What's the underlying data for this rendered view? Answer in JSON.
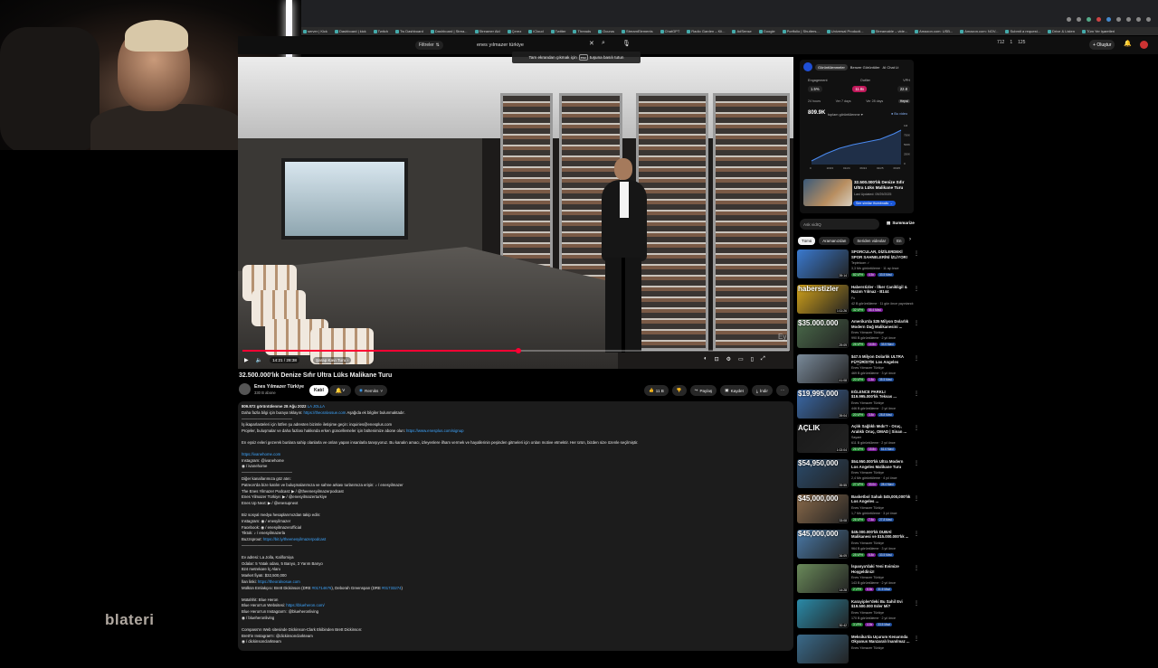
{
  "browser": {
    "bookmarks": [
      "server | Kick",
      "Dashboard | kick",
      "Twitch",
      "Tw Dashboard",
      "Dashboard | Strea...",
      "Streamer Aid",
      "Çerez",
      "iCloud",
      "Twitter",
      "Threads",
      "Ocurus",
      "StreamElements",
      "ChatGPT",
      "Radio Garden – Kli...",
      "AdSense",
      "Google",
      "Portfolio | Shutters...",
      "Universal Producti...",
      "Streamable – vide...",
      "Amazon.com: USB...",
      "Amazon.com: NOV...",
      "Submit a request...",
      "Drive & Listen",
      "Tüm Yer işaretleri"
    ]
  },
  "youtube": {
    "filters_label": "Filtreler",
    "search_query": "enes yılmazer türkiye",
    "create_label": "Oluştur",
    "counters": [
      "712",
      "1",
      "125"
    ],
    "toast": {
      "before": "Tam ekrandan çıkmak için",
      "key": "esc",
      "after": "tuşuna basılı tutun"
    }
  },
  "player": {
    "time": "14:21 / 28:38",
    "chapter": "Şarap Kavı Turu ›",
    "progress_fraction": 0.505,
    "watermark": "Ey"
  },
  "video": {
    "title": "32.500.000'lık Denize Sıfır Ultra Lüks Malikane Turu",
    "channel": "Enes Yılmazer Türkiye",
    "subscribers": "330 B abone",
    "join": "Katıl",
    "remix": "Remiks",
    "likes": "11 B",
    "share": "Paylaş",
    "save": "Kaydet",
    "download": "İndir"
  },
  "description": {
    "stats": "809.872 görüntülenme  28 Ağu 2022",
    "stats_link": "LA JOLLA",
    "lines": [
      [
        {
          "t": "Daha fazla bilgi için buraya tıklayın: "
        },
        {
          "t": "https://theoralvosue.com",
          "l": 1
        },
        {
          "t": " Aşağıda ek bilgiler bulunmaktadır."
        }
      ],
      [
        {
          "t": "—————————————"
        }
      ],
      [
        {
          "t": "İş ikaparlasteleri için lütfen şu adresten bizimle iletişime geçin: inquiries@enesplus.com"
        }
      ],
      [
        {
          "t": "Projeler, buluşmalar ve daha fazlası hakkında erken güncellemeler için bültenimize abone olun: "
        },
        {
          "t": "https://www.enesplus.com/signup",
          "l": 1
        }
      ],
      [],
      [
        {
          "t": "En eşsiz evleri gezerek bunlara sahip olanlarla ve onları yapan insanlarla tanışıyoruz. Bu kanalın amacı, izleyenlere ilham vermek ve hayallerinin peşinden gitmeleri için onları motive etmektir. Her ürün, bizden size özenle seçilmiştir."
        }
      ],
      [],
      [
        {
          "t": "https://ivanehome.com",
          "l": 1
        }
      ],
      [
        {
          "t": "Instagram: @ivanehome"
        }
      ],
      [
        {
          "t": "◉ / ivanehome"
        }
      ],
      [
        {
          "t": "—————————————"
        }
      ],
      [
        {
          "t": "Diğer kanallarımıza göz atın:"
        }
      ],
      [
        {
          "t": "Patreon'da bize katılın ve buluşmalarımıza ve sahne arkası turlarımıza erişin: ♪ / enesyilmazer"
        }
      ],
      [
        {
          "t": "The Enes Yilmazer Podcast: ▶ / @theenesyilmazerpodcast"
        }
      ],
      [
        {
          "t": "Enes Yilmazer Türkiye: ▶ / @enesyilmazerturkiye"
        }
      ],
      [
        {
          "t": "Enes Up Next: ▶ / @enesupnext"
        }
      ],
      [],
      [
        {
          "t": "Biz sosyal medya hesaplarımızdan takip edin:"
        }
      ],
      [
        {
          "t": "Instagram: ◉ / enesyilmazer"
        }
      ],
      [
        {
          "t": "Facebook: ◉ / enesyilmazerofficial"
        }
      ],
      [
        {
          "t": "Tiktok: ♪ / enesyilmazerla"
        }
      ],
      [
        {
          "t": "Buzzsprout: "
        },
        {
          "t": "https://bit.ly/theenesyilmazerpodcast",
          "l": 1
        }
      ],
      [
        {
          "t": "—————————————"
        }
      ],
      [],
      [
        {
          "t": "Ev adresi: La Jolla, Kaliforniya"
        }
      ],
      [
        {
          "t": "Odalar: 5 Yatak odası, 5 Banyo, 3 Yarım Banyo"
        }
      ],
      [
        {
          "t": "824 metrekare İç Alanı"
        }
      ],
      [
        {
          "t": "Market fiyatı: $32,500,000"
        }
      ],
      [
        {
          "t": "İlan linki: "
        },
        {
          "t": "https://theoralvosue.com",
          "l": 1
        }
      ],
      [
        {
          "t": "Mülkün Emlakçısı: Brett Dickinson (DRE "
        },
        {
          "t": "#01714676",
          "l": 1
        },
        {
          "t": "), Deborah Greenspan (DRE "
        },
        {
          "t": "#01733274",
          "l": 1
        },
        {
          "t": ")"
        }
      ],
      [],
      [
        {
          "t": "Mütahhit: Blue Heron"
        }
      ],
      [
        {
          "t": "Blue Heron'un Websitesi: "
        },
        {
          "t": "https://blueheron.com/",
          "l": 1
        }
      ],
      [
        {
          "t": "Blue Heron'un Instagram'ı: @blueheronliving"
        }
      ],
      [
        {
          "t": "◉ / blueheronliving"
        }
      ],
      [],
      [
        {
          "t": "Compass'ın Web sitesinde Dickinson-Clark Ekibinden Brett Dickinson:"
        }
      ],
      [
        {
          "t": "Brett'in Instagram'ı: @dickinsonclarkteam"
        }
      ],
      [
        {
          "t": "◉ / dickinsonclarkteam"
        }
      ]
    ]
  },
  "side_panel": {
    "tabs": [
      "Görüntülenmeler",
      "Benzer Görüntüler",
      "AI Chat Lt"
    ],
    "metric_labels": [
      "Engagement",
      "Outlier",
      "VPH"
    ],
    "metric_values": [
      "1.5%",
      "11.8x",
      "22.8"
    ],
    "ranges": [
      "24 hours",
      "Ver 7 days",
      "Ver 28 days",
      "Hepsi"
    ],
    "views": "809.9K",
    "views_label": "toplam görüntülenme ▾",
    "views_right": "● Bu video",
    "y_ticks": [
      "1M",
      "750K",
      "500K",
      "250K",
      "0"
    ],
    "x_ticks": [
      "0",
      "10/23",
      "01/24",
      "06/24",
      "02/25",
      "09/25"
    ],
    "card_title": "32.500.000'lık Denize Sıfır Ultra Lüks Malikane Turu",
    "card_sub": "Last Updated: 09/29/2025",
    "card_button": "See similar thumbnails →",
    "ask_placeholder": "Ask vidIQ",
    "summarize": "Summarize",
    "chips": [
      "Tümü",
      "Aramanızdan",
      "Seriden videolar",
      "En"
    ]
  },
  "recommendations": [
    {
      "title": "SPORCULAR, DİZİLERDEKİ SPOR SAHNELERİNİ İZLİYOR!",
      "channel": "Teptelcom ✓",
      "meta": "3,3 Mn görüntüleme · 11 ay önce",
      "badges": [
        "82 VPH",
        "4.5x",
        "33.5 Mavi"
      ],
      "duration": "39:14",
      "overlay": "",
      "color": "#3a7ad0"
    },
    {
      "title": "Haberstizler - İlker Canikligil & Nazım Yılmaz - B144",
      "channel": "Fu",
      "meta": "42 B görüntüleme · 11 gün önce yayınlandı",
      "badges": [
        "32 VPH",
        "55.4 Mavi"
      ],
      "duration": "1:11:26",
      "overlay": "haberstizler",
      "color": "#d2a21a"
    },
    {
      "title": "Amerika'da $35 Milyon Dolarlık Modern Dağ Malikanesini ...",
      "channel": "Enes Yılmazer Türkiye",
      "meta": "990 B görüntüleme · 2 yıl önce",
      "badges": [
        "26 VPH",
        "14.8x",
        "33.5 Mavi"
      ],
      "duration": "29:09",
      "overlay": "$35.000.000",
      "color": "#4a6a4a"
    },
    {
      "title": "$47.5 Milyon Dolarlık ULTRA FÜTÜRİSTİK Los Angeles Malikanesi ...",
      "channel": "Enes Yılmazer Türkiye",
      "meta": "469 B görüntüleme · 3 yıl önce",
      "badges": [
        "20 VPH",
        "1.8x",
        "35.5 Mavi"
      ],
      "duration": "41:08",
      "overlay": "",
      "color": "#7a8a9a"
    },
    {
      "title": "EĞLENCE PARKLI $19.995.000'lık Teksas ...",
      "channel": "Enes Yılmazer Türkiye",
      "meta": "446 B görüntüleme · 2 yıl önce",
      "badges": [
        "20 VPH",
        "3.8x",
        "28.8 Mavi"
      ],
      "duration": "39:04",
      "overlay": "$19,995,000",
      "color": "#3a6aaa"
    },
    {
      "title": "Açlık Sağlıklı Mıdır? - Oruç, Aralıklı Oruç, OMAD | Sinan ...",
      "channel": "Sayam",
      "meta": "611 B görüntüleme · 2 yıl önce",
      "badges": [
        "26 VPH",
        "15.8x",
        "61.6 Mavi"
      ],
      "duration": "1:02:04",
      "overlay": "AÇLIK",
      "color": "#1a1a1a"
    },
    {
      "title": "$54.950.000'lık Ultra Modern Los Angeles Malikane Turu",
      "channel": "Enes Yılmazer Türkiye",
      "meta": "2,4 Mn görüntüleme · 4 yıl önce",
      "badges": [
        "27 VPH",
        "33.0x",
        "28.4 Mavi"
      ],
      "duration": "39:55",
      "overlay": "$54,950,000",
      "color": "#2a4a6a"
    },
    {
      "title": "Basketbol Sahalı $45,000,000'lık Los Angeles ...",
      "channel": "Enes Yılmazer Türkiye",
      "meta": "1,7 Mn görüntüleme · 3 yıl önce",
      "badges": [
        "26 VPH",
        "7.8x",
        "27.8 Mavi"
      ],
      "duration": "33:08",
      "overlay": "$45,000,000",
      "color": "#8a6a4a"
    },
    {
      "title": "$45.000.000'lık DUBAİ Malikanesi ve $15.000.000'lık ...",
      "channel": "Enes Yılmazer Türkiye",
      "meta": "964 B görüntüleme · 3 yıl önce",
      "badges": [
        "25 VPH",
        "6.8x",
        "33.5 Mavi"
      ],
      "duration": "36:09",
      "overlay": "$45,000,000",
      "color": "#4a7aa8"
    },
    {
      "title": "İspanya'daki Yeni Evimize Hoşgeldiniz!",
      "channel": "Enes Yılmazer Türkiye",
      "meta": "143 B görüntüleme · 2 yıl önce",
      "badges": [
        "2 VPH",
        "6.8x",
        "31.5 Mavi"
      ],
      "duration": "14:28",
      "overlay": "",
      "color": "#6a8a5a"
    },
    {
      "title": "Karayipler'deki Bu Sahil Evi $19.500.000 Eder Mi?",
      "channel": "Enes Yılmazer Türkiye",
      "meta": "170 B görüntüleme · 2 yıl önce",
      "badges": [
        "3 VPH",
        "4.8x",
        "33.5 Mavi"
      ],
      "duration": "30:42",
      "overlay": "",
      "color": "#2a8aa8"
    },
    {
      "title": "Meksika'da Uçurum Kenarında Okyanus Manzaralı İnanılmaz ...",
      "channel": "Enes Yılmazer Türkiye",
      "meta": "",
      "badges": [],
      "duration": "",
      "overlay": "",
      "color": "#3a6a8a"
    }
  ],
  "overlay_text": "blateri"
}
